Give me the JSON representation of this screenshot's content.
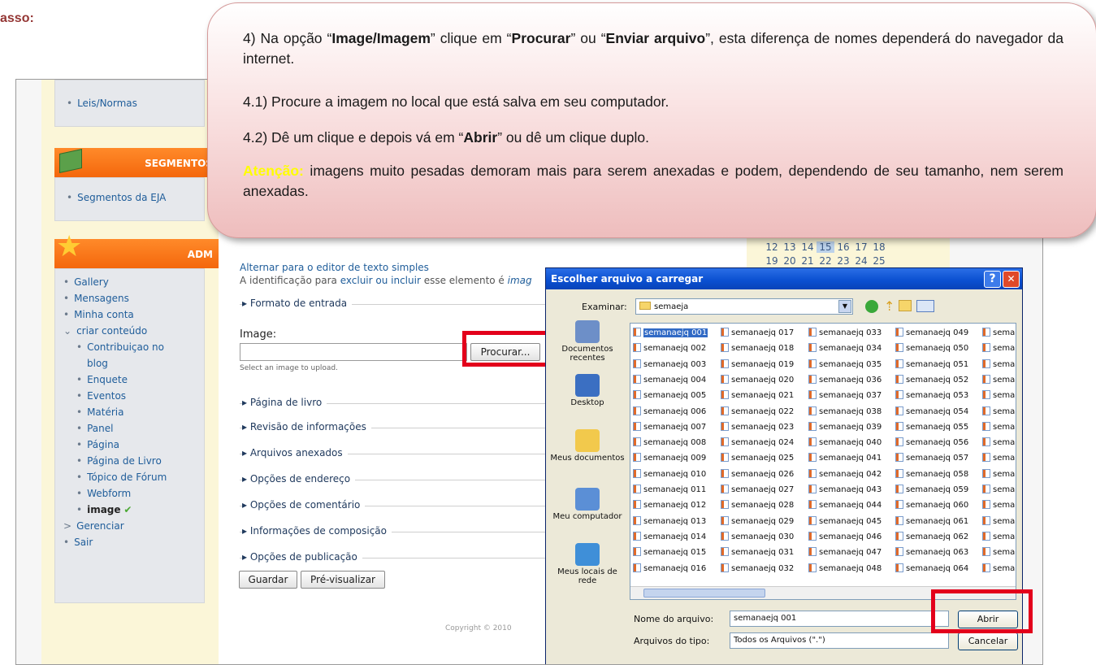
{
  "step_title": "asso:",
  "callout": {
    "p1_a": "4) Na opção “",
    "p1_b": "Image/Imagem",
    "p1_c": "” clique em “",
    "p1_d": "Procurar",
    "p1_e": "” ou “",
    "p1_f": "Enviar arquivo",
    "p1_g": "”, esta diferença de nomes dependerá do navegador da internet.",
    "p2": "4.1) Procure a imagem no local que está salva em seu computador.",
    "p3_a": "4.2) Dê um clique e depois vá em “",
    "p3_b": "Abrir",
    "p3_c": "” ou dê um clique duplo.",
    "p4_warn": "Atenção:",
    "p4_rest": " imagens muito pesadas demoram mais para serem anexadas e podem, dependendo de seu tamanho, nem serem anexadas."
  },
  "sidebar": {
    "top_link": "Leis/Normas",
    "segments_header": "SEGMENTOS",
    "segments_link": "Segmentos da EJA",
    "adm_header": "ADM",
    "menu": [
      {
        "label": "Gallery",
        "bullet": "•"
      },
      {
        "label": "Mensagens",
        "bullet": "•"
      },
      {
        "label": "Minha conta",
        "bullet": "•"
      },
      {
        "label": "criar conteúdo",
        "bullet": "⌄"
      },
      {
        "label": "Contribuiçao no",
        "bullet": "•",
        "indent": true
      },
      {
        "label": "blog",
        "bullet": "",
        "indent": true
      },
      {
        "label": "Enquete",
        "bullet": "•",
        "indent": true
      },
      {
        "label": "Eventos",
        "bullet": "•",
        "indent": true
      },
      {
        "label": "Matéria",
        "bullet": "•",
        "indent": true
      },
      {
        "label": "Panel",
        "bullet": "•",
        "indent": true
      },
      {
        "label": "Página",
        "bullet": "•",
        "indent": true
      },
      {
        "label": "Página de Livro",
        "bullet": "•",
        "indent": true
      },
      {
        "label": "Tópico de Fórum",
        "bullet": "•",
        "indent": true
      },
      {
        "label": "Webform",
        "bullet": "•",
        "indent": true
      },
      {
        "label": "image",
        "bullet": "•",
        "indent": true,
        "active": true
      },
      {
        "label": "Gerenciar",
        "bullet": ">"
      },
      {
        "label": "Sair",
        "bullet": "•"
      }
    ]
  },
  "calendar": {
    "week3": [
      "12",
      "13",
      "14",
      "15",
      "16",
      "17",
      "18"
    ],
    "week4": [
      "19",
      "20",
      "21",
      "22",
      "23",
      "24",
      "25"
    ],
    "today": "15"
  },
  "form": {
    "toggle_editor": "Alternar para o editor de texto simples",
    "id_hint_a": "A identificação para ",
    "id_hint_b": "excluir ou incluir",
    "id_hint_c": " esse elemento é ",
    "id_hint_d": "imag",
    "input_format": "Formato de entrada",
    "image_label": "Image:",
    "browse_button": "Procurar...",
    "image_help": "Select an image to upload.",
    "sections": [
      "Página de livro",
      "Revisão de informações",
      "Arquivos anexados",
      "Opções de endereço",
      "Opções de comentário",
      "Informações de composição",
      "Opções de publicação"
    ],
    "save_button": "Guardar",
    "preview_button": "Pré-visualizar",
    "copyright": "Copyright © 2010"
  },
  "dialog": {
    "title": "Escolher arquivo a carregar",
    "help_btn": "?",
    "close_btn": "✕",
    "look_in_label": "Examinar:",
    "look_in_value": "semaeja",
    "places": [
      "Documentos recentes",
      "Desktop",
      "Meus documentos",
      "Meu computador",
      "Meus locais de rede"
    ],
    "files_col1": [
      "semanaejq 001",
      "semanaejq 002",
      "semanaejq 003",
      "semanaejq 004",
      "semanaejq 005",
      "semanaejq 006",
      "semanaejq 007",
      "semanaejq 008",
      "semanaejq 009",
      "semanaejq 010",
      "semanaejq 011",
      "semanaejq 012",
      "semanaejq 013",
      "semanaejq 014",
      "semanaejq 015",
      "semanaejq 016"
    ],
    "files_col2": [
      "semanaejq 017",
      "semanaejq 018",
      "semanaejq 019",
      "semanaejq 020",
      "semanaejq 021",
      "semanaejq 022",
      "semanaejq 023",
      "semanaejq 024",
      "semanaejq 025",
      "semanaejq 026",
      "semanaejq 027",
      "semanaejq 028",
      "semanaejq 029",
      "semanaejq 030",
      "semanaejq 031",
      "semanaejq 032"
    ],
    "files_col3": [
      "semanaejq 033",
      "semanaejq 034",
      "semanaejq 035",
      "semanaejq 036",
      "semanaejq 037",
      "semanaejq 038",
      "semanaejq 039",
      "semanaejq 040",
      "semanaejq 041",
      "semanaejq 042",
      "semanaejq 043",
      "semanaejq 044",
      "semanaejq 045",
      "semanaejq 046",
      "semanaejq 047",
      "semanaejq 048"
    ],
    "files_col4": [
      "semanaejq 049",
      "semanaejq 050",
      "semanaejq 051",
      "semanaejq 052",
      "semanaejq 053",
      "semanaejq 054",
      "semanaejq 055",
      "semanaejq 056",
      "semanaejq 057",
      "semanaejq 058",
      "semanaejq 059",
      "semanaejq 060",
      "semanaejq 061",
      "semanaejq 062",
      "semanaejq 063",
      "semanaejq 064"
    ],
    "files_col5": "sema",
    "filename_label": "Nome do arquivo:",
    "filename_value": "semanaejq 001",
    "filetype_label": "Arquivos do tipo:",
    "filetype_value": "Todos os Arquivos (\".\")",
    "open_button": "Abrir",
    "cancel_button": "Cancelar"
  },
  "colors": {
    "highlight_red": "#e3001b",
    "callout_pink": "#f8dcdc",
    "warning_yellow": "#ffff00",
    "step_title": "#943634",
    "dialog_title_blue": "#0a4fd0"
  }
}
